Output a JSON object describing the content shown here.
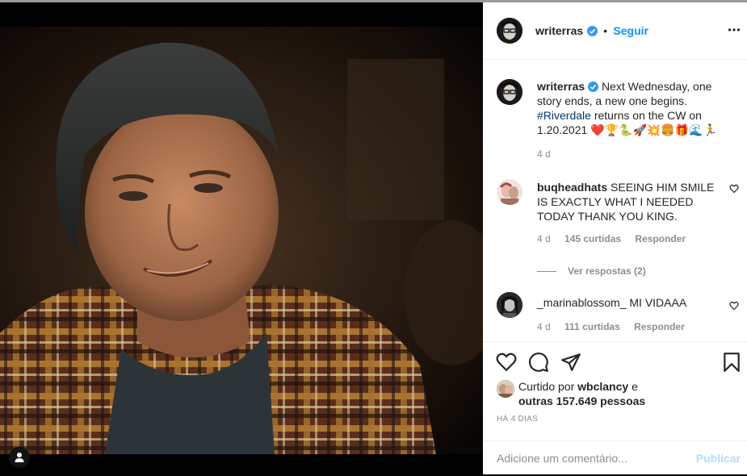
{
  "post": {
    "author": "writerras",
    "follow_label": "Seguir"
  },
  "caption": {
    "author": "writerras",
    "text_line1": "Next Wednesday, one",
    "text_line2": "story ends, a new one begins.",
    "hashtag": "#Riverdale",
    "text_line3_rest": " returns on the CW on",
    "text_line4": "1.20.2021 ❤️🏆🐍🚀💥🍔🎁🌊🏃",
    "time": "4 d"
  },
  "comments": [
    {
      "author": "buqheadhats",
      "text": "SEEING HIM SMILE IS EXACTLY WHAT I NEEDED TODAY THANK YOU KING.",
      "time": "4 d",
      "likes": "145 curtidas",
      "reply": "Responder",
      "view_replies": "Ver respostas (2)"
    },
    {
      "author": "_marinablossom_",
      "text": "MI VIDAAA",
      "time": "4 d",
      "likes": "111 curtidas",
      "reply": "Responder"
    }
  ],
  "likes": {
    "prefix": "Curtido por",
    "user": "wbclancy",
    "mid": "e",
    "others": "outras 157.649 pessoas"
  },
  "date": "HÁ 4 DIAS",
  "add_comment": {
    "placeholder": "Adicione um comentário...",
    "publish": "Publicar"
  },
  "colors": {
    "accent": "#0095f6",
    "text": "#262626",
    "muted": "#8e8e8e"
  }
}
